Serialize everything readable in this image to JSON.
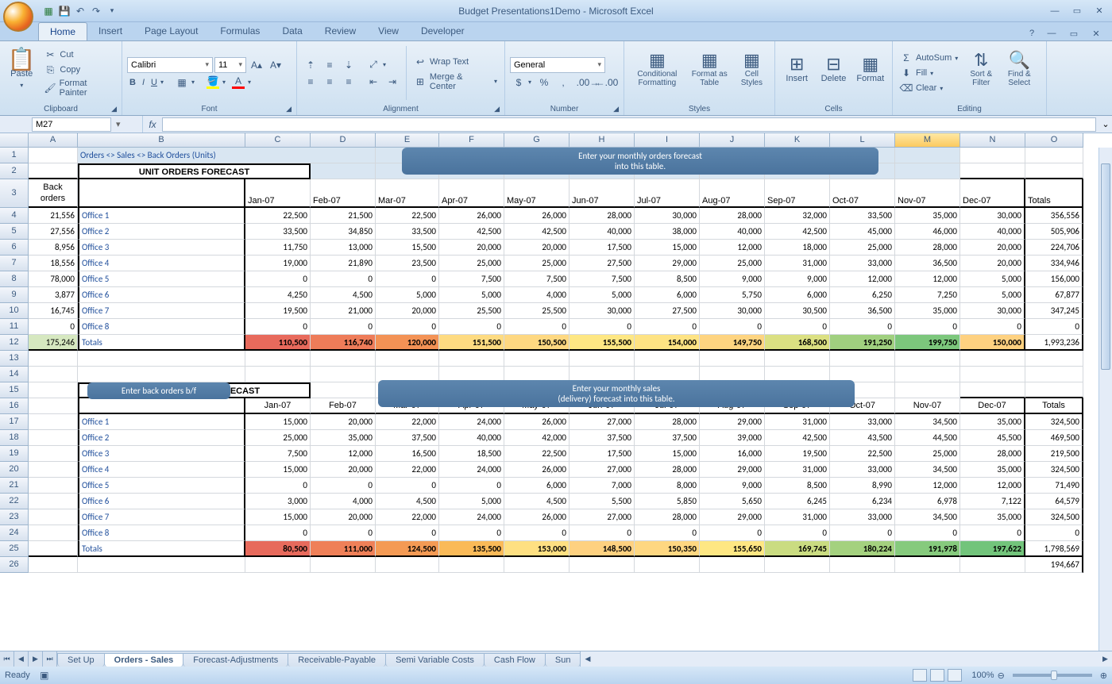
{
  "app": {
    "title": "Budget Presentations1Demo - Microsoft Excel",
    "ready": "Ready"
  },
  "tabs": [
    "Home",
    "Insert",
    "Page Layout",
    "Formulas",
    "Data",
    "Review",
    "View",
    "Developer"
  ],
  "active_tab": "Home",
  "clipboard": {
    "paste": "Paste",
    "cut": "Cut",
    "copy": "Copy",
    "fp": "Format Painter",
    "label": "Clipboard"
  },
  "font": {
    "name": "Calibri",
    "size": "11",
    "label": "Font"
  },
  "alignment": {
    "wrap": "Wrap Text",
    "merge": "Merge & Center",
    "label": "Alignment"
  },
  "number": {
    "fmt": "General",
    "label": "Number"
  },
  "styles": {
    "cond": "Conditional Formatting",
    "table": "Format as Table",
    "cell": "Cell Styles",
    "label": "Styles"
  },
  "cells": {
    "insert": "Insert",
    "delete": "Delete",
    "format": "Format",
    "label": "Cells"
  },
  "editing": {
    "autosum": "AutoSum",
    "fill": "Fill",
    "clear": "Clear",
    "sort": "Sort & Filter",
    "find": "Find & Select",
    "label": "Editing"
  },
  "namebox": "M27",
  "cols": {
    "A": 62,
    "B": 211,
    "C": 82,
    "D": 82,
    "E": 80,
    "F": 82,
    "G": 82,
    "H": 82,
    "I": 82,
    "J": 82,
    "K": 82,
    "L": 82,
    "M": 82,
    "N": 82,
    "O": 73
  },
  "sel_col": "M",
  "headers": {
    "back_orders": "Back orders",
    "totals": "Totals"
  },
  "months": [
    "Jan-07",
    "Feb-07",
    "Mar-07",
    "Apr-07",
    "May-07",
    "Jun-07",
    "Jul-07",
    "Aug-07",
    "Sep-07",
    "Oct-07",
    "Nov-07",
    "Dec-07"
  ],
  "breadcrumb": "Orders <> Sales <> Back Orders (Units)",
  "orders_title": "UNIT ORDERS FORECAST",
  "sales_title": "SALES (DELIVERY) FORECAST",
  "callout_orders_l1": "Enter your monthly orders forecast",
  "callout_orders_l2": "into this table.",
  "callout_sales_l1": "Enter your monthly sales",
  "callout_sales_l2": "(delivery) forecast into this table.",
  "callout_back": "Enter back orders b/f",
  "offices": [
    "Office 1",
    "Office 2",
    "Office 3",
    "Office 4",
    "Office 5",
    "Office 6",
    "Office 7",
    "Office 8"
  ],
  "totals_label": "Totals",
  "back_orders": [
    "21,556",
    "27,556",
    "8,956",
    "18,556",
    "78,000",
    "3,877",
    "16,745",
    "0"
  ],
  "back_orders_total": "175,246",
  "orders_data": [
    [
      "22,500",
      "21,500",
      "22,500",
      "26,000",
      "26,000",
      "28,000",
      "30,000",
      "28,000",
      "32,000",
      "33,500",
      "35,000",
      "30,000",
      "356,556"
    ],
    [
      "33,500",
      "34,850",
      "33,500",
      "42,500",
      "42,500",
      "40,000",
      "38,000",
      "40,000",
      "42,500",
      "45,000",
      "46,000",
      "40,000",
      "505,906"
    ],
    [
      "11,750",
      "13,000",
      "15,500",
      "20,000",
      "20,000",
      "17,500",
      "15,000",
      "12,000",
      "18,000",
      "25,000",
      "28,000",
      "20,000",
      "224,706"
    ],
    [
      "19,000",
      "21,890",
      "23,500",
      "25,000",
      "25,000",
      "27,500",
      "29,000",
      "25,000",
      "31,000",
      "33,000",
      "36,500",
      "20,000",
      "334,946"
    ],
    [
      "0",
      "0",
      "0",
      "7,500",
      "7,500",
      "7,500",
      "8,500",
      "9,000",
      "9,000",
      "12,000",
      "12,000",
      "5,000",
      "156,000"
    ],
    [
      "4,250",
      "4,500",
      "5,000",
      "5,000",
      "4,000",
      "5,000",
      "6,000",
      "5,750",
      "6,000",
      "6,250",
      "7,250",
      "5,000",
      "67,877"
    ],
    [
      "19,500",
      "21,000",
      "20,000",
      "25,500",
      "25,500",
      "30,000",
      "27,500",
      "30,000",
      "30,500",
      "36,500",
      "35,000",
      "30,000",
      "347,245"
    ],
    [
      "0",
      "0",
      "0",
      "0",
      "0",
      "0",
      "0",
      "0",
      "0",
      "0",
      "0",
      "0",
      "0"
    ]
  ],
  "orders_totals": [
    "110,500",
    "116,740",
    "120,000",
    "151,500",
    "150,500",
    "155,500",
    "154,000",
    "149,750",
    "168,500",
    "191,250",
    "199,750",
    "150,000",
    "1,993,236"
  ],
  "sales_data": [
    [
      "15,000",
      "20,000",
      "22,000",
      "24,000",
      "26,000",
      "27,000",
      "28,000",
      "29,000",
      "31,000",
      "33,000",
      "34,500",
      "35,000",
      "324,500"
    ],
    [
      "25,000",
      "35,000",
      "37,500",
      "40,000",
      "42,000",
      "37,500",
      "37,500",
      "39,000",
      "42,500",
      "43,500",
      "44,500",
      "45,500",
      "469,500"
    ],
    [
      "7,500",
      "12,000",
      "16,500",
      "18,500",
      "22,500",
      "17,500",
      "15,000",
      "16,000",
      "19,500",
      "22,500",
      "25,000",
      "28,000",
      "219,500"
    ],
    [
      "15,000",
      "20,000",
      "22,000",
      "24,000",
      "26,000",
      "27,000",
      "28,000",
      "29,000",
      "31,000",
      "33,000",
      "34,500",
      "35,000",
      "324,500"
    ],
    [
      "0",
      "0",
      "0",
      "0",
      "6,000",
      "7,000",
      "8,000",
      "9,000",
      "8,500",
      "8,990",
      "12,000",
      "12,000",
      "71,490"
    ],
    [
      "3,000",
      "4,000",
      "4,500",
      "5,000",
      "4,500",
      "5,500",
      "5,850",
      "5,650",
      "6,245",
      "6,234",
      "6,978",
      "7,122",
      "64,579"
    ],
    [
      "15,000",
      "20,000",
      "22,000",
      "24,000",
      "26,000",
      "27,000",
      "28,000",
      "29,000",
      "31,000",
      "33,000",
      "34,500",
      "35,000",
      "324,500"
    ],
    [
      "0",
      "0",
      "0",
      "0",
      "0",
      "0",
      "0",
      "0",
      "0",
      "0",
      "0",
      "0",
      "0"
    ]
  ],
  "sales_totals": [
    "80,500",
    "111,000",
    "124,500",
    "135,500",
    "153,000",
    "148,500",
    "150,350",
    "155,650",
    "169,745",
    "180,224",
    "191,978",
    "197,622",
    "1,798,569"
  ],
  "row26_last": "194,667",
  "orders_total_colors": [
    "#e86a5c",
    "#ee7c59",
    "#f39255",
    "#fedb81",
    "#fed881",
    "#fee783",
    "#fee383",
    "#fed480",
    "#dbe082",
    "#a0d07f",
    "#7cc77c",
    "#fed180"
  ],
  "sales_total_colors": [
    "#e76a5c",
    "#ef8058",
    "#f49a54",
    "#faba58",
    "#fee082",
    "#fed180",
    "#fed781",
    "#fee783",
    "#cadc81",
    "#a4d17f",
    "#86ca7d",
    "#72c47b"
  ],
  "sheet_tabs": [
    "Set Up",
    "Orders - Sales",
    "Forecast-Adjustments",
    "Receivable-Payable",
    "Semi Variable Costs",
    "Cash Flow",
    "Sun"
  ],
  "active_sheet": "Orders - Sales",
  "zoom": "100%"
}
